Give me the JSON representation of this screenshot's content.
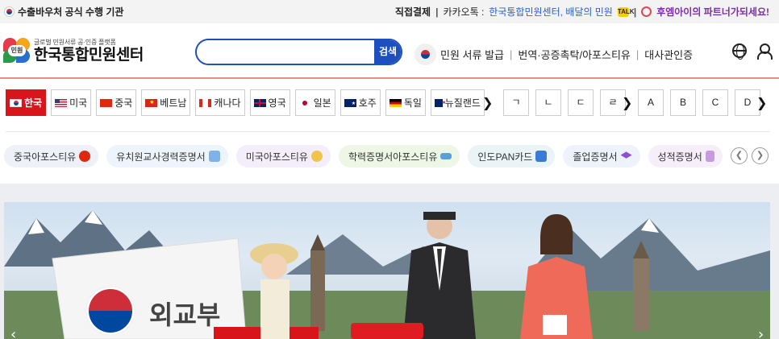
{
  "topbar": {
    "left_text": "수출바우처 공식 수행 기관",
    "direct_pay": "직접결제",
    "kakao_label": "카카오톡 :",
    "kakao_link": "한국통합민원센터, 배달의 민원",
    "talk_badge": "TALK",
    "partner_text": "후엠아이의 파트너가되세요!"
  },
  "header": {
    "logo_tag": "민원",
    "logo_small": "글로벌 민원서류 공·인증 플랫폼",
    "logo_big": "한국통합민원센터",
    "search_placeholder": "",
    "search_button": "검색",
    "menu": [
      "민원 서류 발급",
      "번역·공증촉탁/아포스티유",
      "대사관인증"
    ]
  },
  "countries": [
    {
      "label": "한국",
      "active": true
    },
    {
      "label": "미국"
    },
    {
      "label": "중국"
    },
    {
      "label": "베트남"
    },
    {
      "label": "캐나다"
    },
    {
      "label": "영국"
    },
    {
      "label": "일본"
    },
    {
      "label": "호주"
    },
    {
      "label": "독일"
    },
    {
      "label": "뉴질랜드"
    }
  ],
  "hangul_index": [
    "ㄱ",
    "ㄴ",
    "ㄷ",
    "ㄹ"
  ],
  "alpha_index": [
    "A",
    "B",
    "C",
    "D"
  ],
  "chips": [
    {
      "label": "중국아포스티유",
      "bg": "#eef2f8"
    },
    {
      "label": "유치원교사경력증명서",
      "bg": "#eef4fb"
    },
    {
      "label": "미국아포스티유",
      "bg": "#f4eefb"
    },
    {
      "label": "학력증명서아포스티유",
      "bg": "#eef6e6"
    },
    {
      "label": "인도PAN카드",
      "bg": "#eaf3f6"
    },
    {
      "label": "졸업증명서",
      "bg": "#eef2fb"
    },
    {
      "label": "성적증명서",
      "bg": "#f6eef8"
    }
  ],
  "banner": {
    "seal_text": "외교부"
  },
  "colors": {
    "brand_blue": "#1d4fbf",
    "active_red": "#d8151a"
  }
}
